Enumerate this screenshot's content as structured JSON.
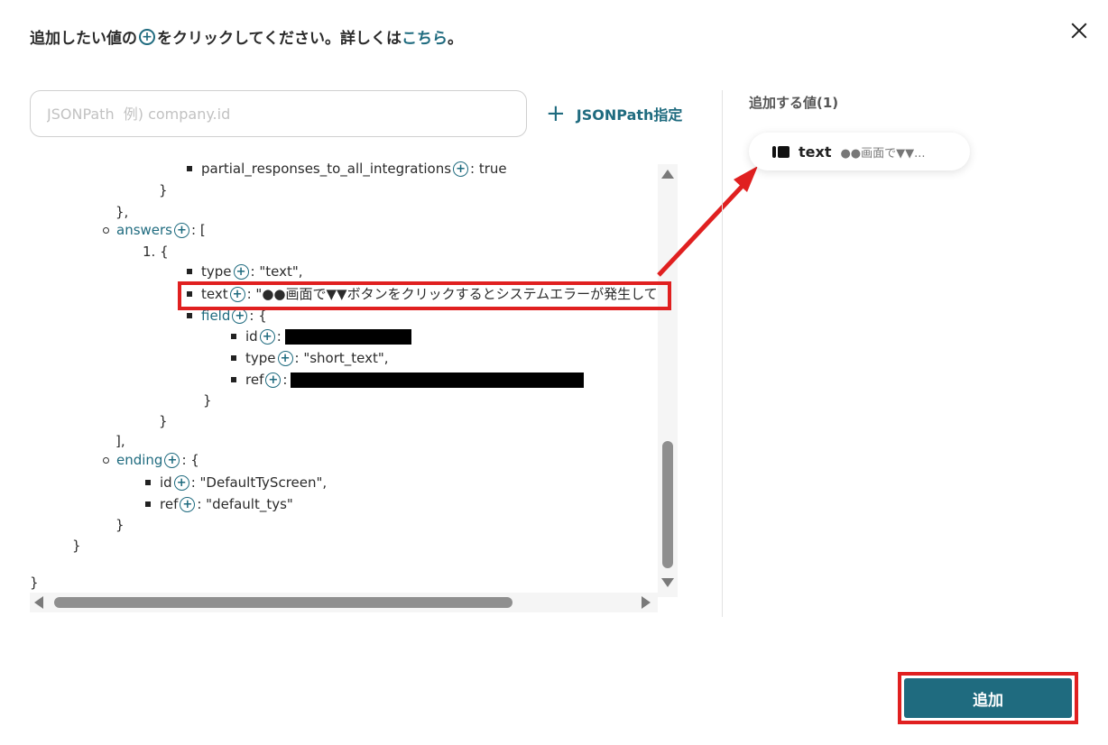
{
  "header": {
    "title_before": "追加したい値の",
    "title_after": "をクリックしてください。詳しくは",
    "title_link": "こちら",
    "title_end": "。"
  },
  "search": {
    "placeholder": "JSONPath  例) company.id",
    "value": ""
  },
  "jsonpath_button": {
    "label": "JSONPath指定",
    "icon": "plus-icon"
  },
  "tree": {
    "lines": {
      "partial_key": "partial_responses_to_all_integrations",
      "partial_val": ": true",
      "brace_close_1": "}",
      "brace_close_2": "},",
      "answers_key": "answers",
      "answers_open": ": [",
      "item_num": "1. {",
      "type_key": "type",
      "type_val": ": \"text\",",
      "text_key": "text",
      "text_val": ": \"●●画面で▼▼ボタンをクリックするとシステムエラーが発生してし",
      "field_key": "field",
      "field_open": ": {",
      "id_key": "id",
      "colon": ":",
      "field_type_key": "type",
      "field_type_val": ": \"short_text\",",
      "ref_key": "ref",
      "brace_close_3": "}",
      "brace_close_4": "}",
      "bracket_close": "],",
      "ending_key": "ending",
      "ending_open": ": {",
      "ending_id_key": "id",
      "ending_id_val": ": \"DefaultTyScreen\",",
      "ending_ref_key": "ref",
      "ending_ref_val": ": \"default_tys\"",
      "brace_close_5": "}",
      "brace_close_6": "}",
      "brace_close_7": "}"
    }
  },
  "added_values": {
    "label": "追加する値(1)",
    "chip": {
      "key": "text",
      "value": "●●画面で▼▼...",
      "icon": "text-type-icon"
    }
  },
  "footer": {
    "add_button_label": "追加"
  },
  "colors": {
    "accent": "#1f6b7f",
    "highlight": "#e02020"
  }
}
